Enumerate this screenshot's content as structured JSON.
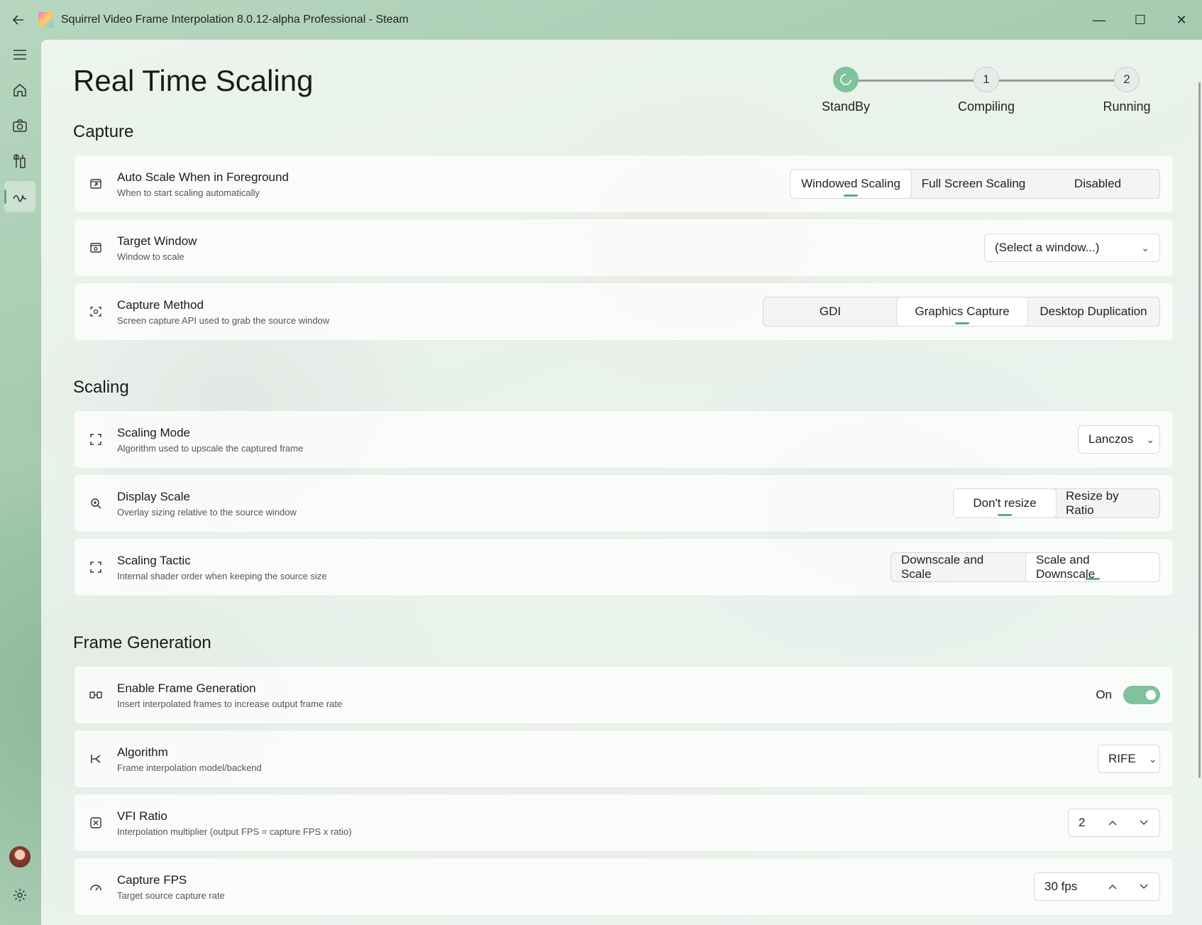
{
  "window": {
    "title": "Squirrel Video Frame Interpolation 8.0.12-alpha  Professional - Steam",
    "back_icon": "back-arrow-icon",
    "minimize": "—",
    "maximize": "☐",
    "close": "✕"
  },
  "nav": {
    "items": [
      {
        "name": "hamburger-menu-icon"
      },
      {
        "name": "home-icon"
      },
      {
        "name": "camera-icon"
      },
      {
        "name": "tools-icon"
      },
      {
        "name": "realtime-icon",
        "active": true
      }
    ]
  },
  "page": {
    "title": "Real Time Scaling"
  },
  "stepper": {
    "steps": [
      {
        "badge": "",
        "label": "StandBy",
        "active": true
      },
      {
        "badge": "1",
        "label": "Compiling"
      },
      {
        "badge": "2",
        "label": "Running"
      }
    ]
  },
  "sections": {
    "capture": "Capture",
    "scaling": "Scaling",
    "frame_generation": "Frame Generation"
  },
  "cards": {
    "auto_scale": {
      "label": "Auto Scale When in Foreground",
      "desc": "When to start scaling automatically",
      "options": [
        "Windowed Scaling",
        "Full Screen Scaling",
        "Disabled"
      ],
      "selected": 0
    },
    "target_window": {
      "label": "Target Window",
      "desc": "Window to scale",
      "value": "(Select a window...)"
    },
    "capture_method": {
      "label": "Capture Method",
      "desc": "Screen capture API used to grab the source window",
      "options": [
        "GDI",
        "Graphics Capture",
        "Desktop Duplication"
      ],
      "selected": 1
    },
    "scaling_mode": {
      "label": "Scaling Mode",
      "desc": "Algorithm used to upscale the captured frame",
      "value": "Lanczos"
    },
    "display_scale": {
      "label": "Display Scale",
      "desc": "Overlay sizing relative to the source window",
      "options": [
        "Don't resize",
        "Resize by Ratio"
      ],
      "selected": 0
    },
    "scaling_tactic": {
      "label": "Scaling Tactic",
      "desc": "Internal shader order when keeping the source size",
      "options": [
        "Downscale and Scale",
        "Scale and Downscale"
      ],
      "selected": 1
    },
    "enable_fg": {
      "label": "Enable Frame Generation",
      "desc": "Insert interpolated frames to increase output frame rate",
      "state": "On"
    },
    "algorithm": {
      "label": "Algorithm",
      "desc": "Frame interpolation model/backend",
      "value": "RIFE"
    },
    "vfi_ratio": {
      "label": "VFI Ratio",
      "desc": "Interpolation multiplier (output FPS = capture FPS x ratio)",
      "value": "2"
    },
    "capture_fps": {
      "label": "Capture FPS",
      "desc": "Target source capture rate",
      "value": "30 fps"
    }
  },
  "colors": {
    "accent": "#7fc29b",
    "accent_dark": "#5fa983"
  }
}
